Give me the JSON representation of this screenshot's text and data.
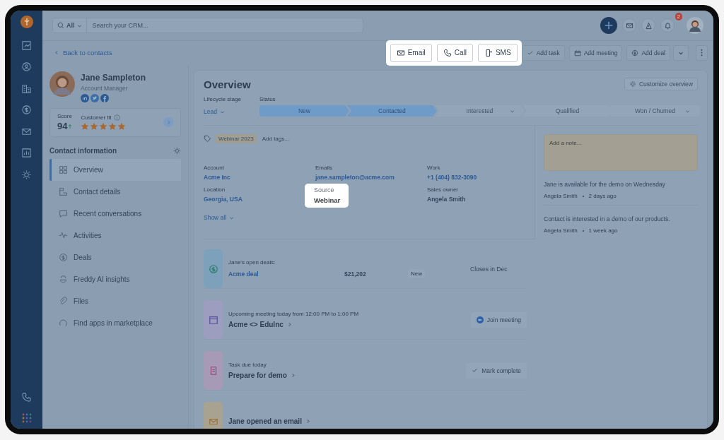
{
  "top_bar": {
    "search_scope": "All",
    "search_placeholder": "Search your CRM...",
    "notification_count": "2"
  },
  "sub_bar": {
    "back_link": "Back to contacts",
    "actions": [
      {
        "label": "Email",
        "highlighted": true
      },
      {
        "label": "Call",
        "highlighted": true
      },
      {
        "label": "SMS",
        "highlighted": true
      },
      {
        "label": "Add task",
        "highlighted": false
      },
      {
        "label": "Add meeting",
        "highlighted": false
      },
      {
        "label": "Add deal",
        "highlighted": false
      }
    ]
  },
  "contact": {
    "name": "Jane Sampleton",
    "title": "Account Manager",
    "score_label": "Score",
    "score": "94",
    "fit_label": "Customer fit",
    "stars": 5
  },
  "contact_info": {
    "heading": "Contact information",
    "items": [
      {
        "label": "Overview",
        "selected": true
      },
      {
        "label": "Contact details",
        "selected": false
      },
      {
        "label": "Recent conversations",
        "selected": false
      },
      {
        "label": "Activities",
        "selected": false
      },
      {
        "label": "Deals",
        "selected": false
      },
      {
        "label": "Freddy AI insights",
        "selected": false
      },
      {
        "label": "Files",
        "selected": false
      },
      {
        "label": "Find apps in marketplace",
        "selected": false
      }
    ]
  },
  "overview": {
    "title": "Overview",
    "customize": "Customize overview",
    "lifecycle_label": "Lifecycle stage",
    "lifecycle_value": "Lead",
    "status_label": "Status",
    "stages": [
      {
        "label": "New",
        "reached": true,
        "menu": false
      },
      {
        "label": "Contacted",
        "reached": true,
        "menu": false
      },
      {
        "label": "Interested",
        "reached": false,
        "menu": true
      },
      {
        "label": "Qualified",
        "reached": false,
        "menu": false
      },
      {
        "label": "Won / Churned",
        "reached": false,
        "menu": true
      }
    ],
    "tags": [
      "Webinar 2023"
    ],
    "tags_placeholder": "Add tags...",
    "fields": [
      {
        "label": "Account",
        "value": "Acme Inc",
        "kind": "link",
        "highlighted": false
      },
      {
        "label": "Emails",
        "value": "jane.sampleton@acme.com",
        "kind": "link",
        "highlighted": false
      },
      {
        "label": "Work",
        "value": "+1 (404) 832-3090",
        "kind": "link",
        "highlighted": false
      },
      {
        "label": "Location",
        "value": "Georgia, USA",
        "kind": "link",
        "highlighted": false
      },
      {
        "label": "Source",
        "value": "Webinar",
        "kind": "text",
        "highlighted": true
      },
      {
        "label": "Sales owner",
        "value": "Angela Smith",
        "kind": "text",
        "highlighted": false
      }
    ],
    "show_all": "Show all",
    "note_placeholder": "Add a note...",
    "notes": [
      {
        "text": "Jane is available for the demo on Wednesday",
        "author": "Angela Smith",
        "time": "2 days ago"
      },
      {
        "text": "Contact is interested in a demo of our products.",
        "author": "Angela Smith",
        "time": "1 week ago"
      }
    ],
    "cards": [
      {
        "kind": "deal",
        "caption": "Jane's open deals:",
        "title": "Acme deal",
        "amount": "$21,202",
        "stage": "New",
        "closes": "Closes in Dec"
      },
      {
        "kind": "meeting",
        "caption": "Upcoming meeting today from 12:00 PM to 1:00 PM",
        "title": "Acme <> EduInc",
        "action": "Join meeting"
      },
      {
        "kind": "task",
        "caption": "Task due today",
        "title": "Prepare for demo",
        "action": "Mark complete"
      },
      {
        "kind": "email",
        "title": "Jane opened an email"
      }
    ]
  }
}
